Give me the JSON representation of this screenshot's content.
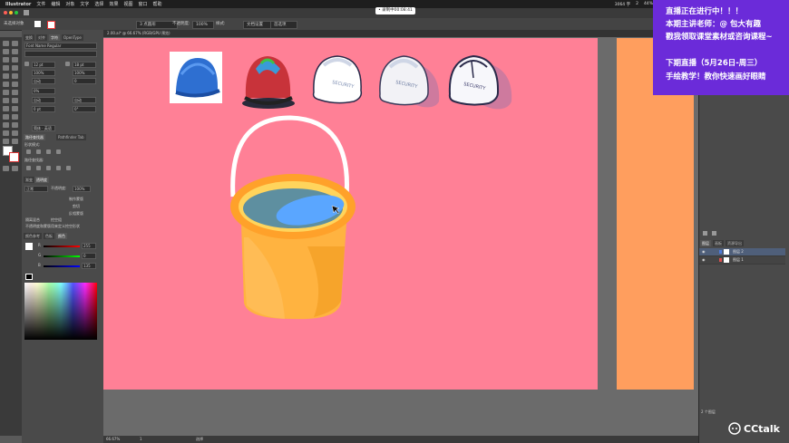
{
  "menubar": {
    "app": "Illustrator",
    "items": [
      "文件",
      "编辑",
      "对象",
      "文字",
      "选择",
      "效果",
      "视图",
      "窗口",
      "帮助"
    ]
  },
  "timer": "• 录制中00:08:41",
  "status": {
    "left": "3064 字",
    "battery": "44%",
    "count": "2"
  },
  "controlbar": {
    "fill_label": "未选择对象",
    "stroke_value": "3 点圆形",
    "opacity_label": "不透明度:",
    "opacity_value": "100%",
    "style_label": "样式:",
    "doc_settings": "文档设置",
    "preferences": "首选项"
  },
  "document_tab": "2.00.ai* @ 66.67% (RGB/GPU 预览)",
  "panel": {
    "tabs": [
      "变换",
      "对齐",
      "字符",
      "OpenType"
    ],
    "font": "Font Name Regular",
    "size1": "12 pt",
    "leading": "18 pt",
    "scale1": "100%",
    "scale2": "100%",
    "auto": "自动",
    "tracking": "0",
    "percent": "0%",
    "auto2": "自动",
    "zero1": "0 pt",
    "zero2": "0°",
    "lang": "简体 · 英语",
    "section_path": "路径查找器",
    "pathfinder_tab": "Pathfinder Tab",
    "shape_modes": "形状模式:",
    "pathfinders": "路径查找器:",
    "transparency_tabs": [
      "渐变",
      "透明度"
    ],
    "blend": "正常",
    "opacity_lbl": "不透明度:",
    "opacity_val": "100%",
    "make_mask": "制作蒙版",
    "clip": "剪切",
    "invert": "反相蒙版",
    "isolate": "隔离混合",
    "knockout": "挖空组",
    "opacity_mask": "不透明度和蒙版用来定义挖空形状",
    "color_tabs": [
      "颜色参考",
      "色板",
      "颜色"
    ],
    "r_val": "255",
    "g_val": "0",
    "b_val": "135"
  },
  "layers": {
    "tabs": [
      "图层",
      "画板",
      "资源导出"
    ],
    "rows": [
      {
        "name": "图层 2",
        "color": "#4f7bd9"
      },
      {
        "name": "图层 1",
        "color": "#d94f4f"
      }
    ],
    "footer": "2 个图层"
  },
  "bottombar": {
    "zoom": "66.67%",
    "page": "1",
    "mode": "选择"
  },
  "promo": {
    "line1": "直播正在进行中！！！",
    "line2": "本期主讲老师：@ 包大有趣",
    "line3": "戳我领取课堂素材或咨询课程~",
    "line4": "下期直播（5月26日-周三）",
    "line5": "手绘教学！教你快速画好眼睛"
  },
  "logo": "CCtalk",
  "helmet_labels": [
    "SECURITY",
    "SECURITY",
    "SECURITY"
  ],
  "colors": {
    "artboard": "#ff8096",
    "artboard2": "#ff9e5e",
    "bucket": "#ffb340",
    "water": "#5e8fa0",
    "water_hl": "#5aa6ff",
    "promo": "#6b2bd9"
  }
}
